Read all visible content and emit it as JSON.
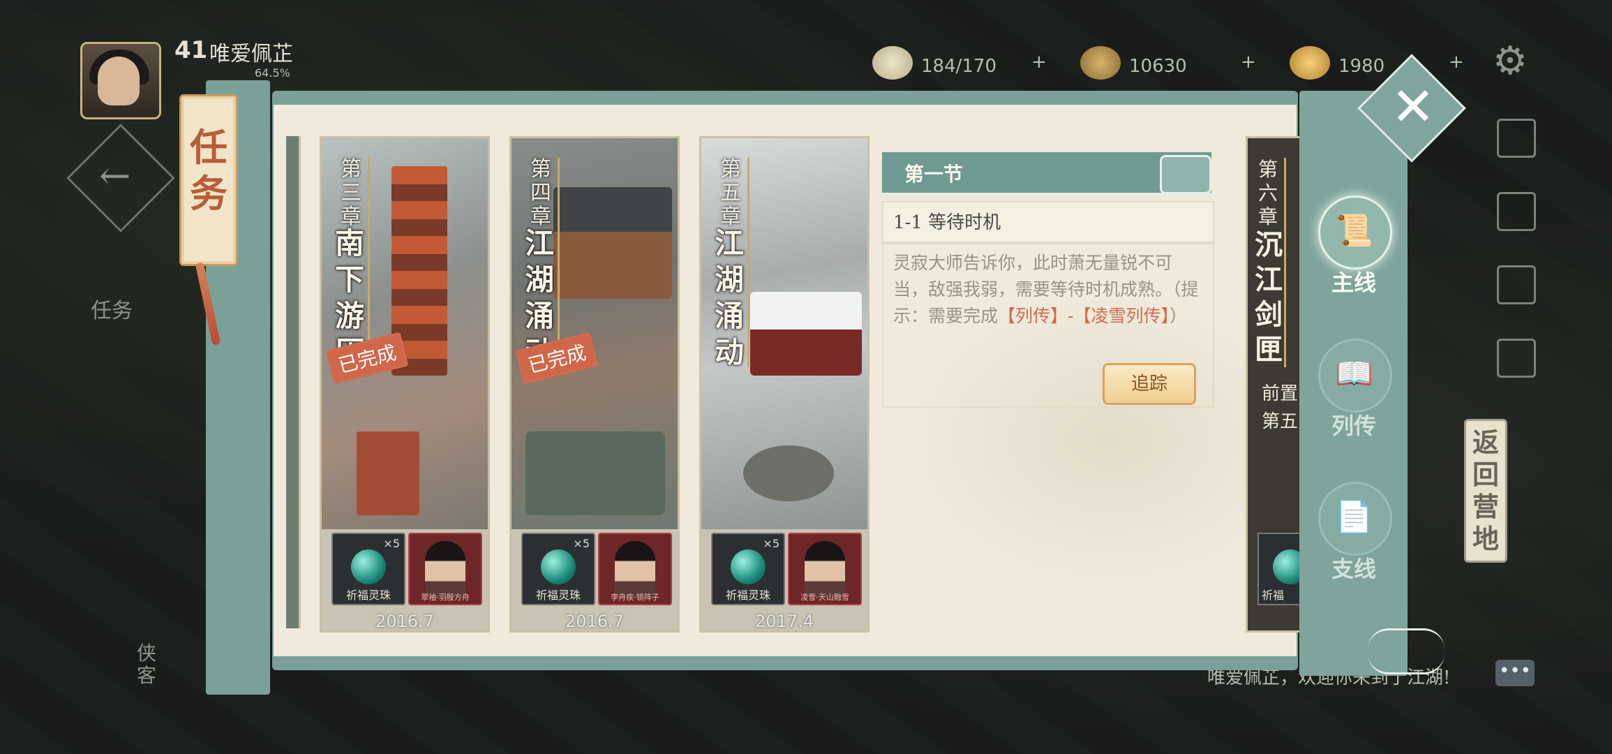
{
  "hud": {
    "level": "41",
    "player_name": "唯爱佩芷",
    "exp_percent": "64.5%",
    "resources": [
      {
        "icon": "rice-bun-icon",
        "value": "184/170"
      },
      {
        "icon": "copper-coin-icon",
        "value": "10630"
      },
      {
        "icon": "gold-ingot-icon",
        "value": "1980"
      }
    ],
    "left_nav": {
      "task_label": "任务",
      "hero_label": "侠客"
    }
  },
  "panel": {
    "tab_title": "任务",
    "chapters": [
      {
        "label": "第三章",
        "title": "南下游历",
        "status": "已完成",
        "date": "2016.7",
        "rewards": [
          {
            "name": "祈福灵珠",
            "count": "×5"
          },
          {
            "name": "翠袖·羽殷方舟"
          }
        ]
      },
      {
        "label": "第四章",
        "title": "江湖涌动",
        "status": "已完成",
        "date": "2016.7",
        "rewards": [
          {
            "name": "祈福灵珠",
            "count": "×5"
          },
          {
            "name": "李舟疾·锁阵子"
          }
        ]
      },
      {
        "label": "第五章",
        "title": "江湖涌动",
        "status": "",
        "date": "2017.4",
        "rewards": [
          {
            "name": "祈福灵珠",
            "count": "×5"
          },
          {
            "name": "凌雪·天山融雪"
          }
        ]
      },
      {
        "label": "第六章",
        "title": "沉江剑匣",
        "prereq_line1": "前置",
        "prereq_line2": "第五",
        "reward_partial": "祈福"
      }
    ],
    "section": {
      "title": "第一节",
      "subtitle": "1-1 等待时机",
      "description": "灵寂大师告诉你，此时萧无量锐不可当，敌强我弱，需要等待时机成熟。",
      "hint_prefix": "（提示：需要完成",
      "hint_link": "【列传】-【凌雪列传】",
      "hint_suffix": "）",
      "track_button": "追踪"
    },
    "right_tabs": [
      {
        "label": "主线",
        "icon": "scroll-icon",
        "active": true
      },
      {
        "label": "列传",
        "icon": "book-icon",
        "active": false
      },
      {
        "label": "支线",
        "icon": "note-icon",
        "active": false
      }
    ]
  },
  "side": {
    "return_camp": "返回营地",
    "chat_text": "唯爱佩芷，欢迎你来到了江湖!",
    "chat_button": "•••"
  },
  "colors": {
    "panel_teal": "#7aa098",
    "accent_red": "#cf6b4e",
    "parchment": "#efeadb"
  }
}
